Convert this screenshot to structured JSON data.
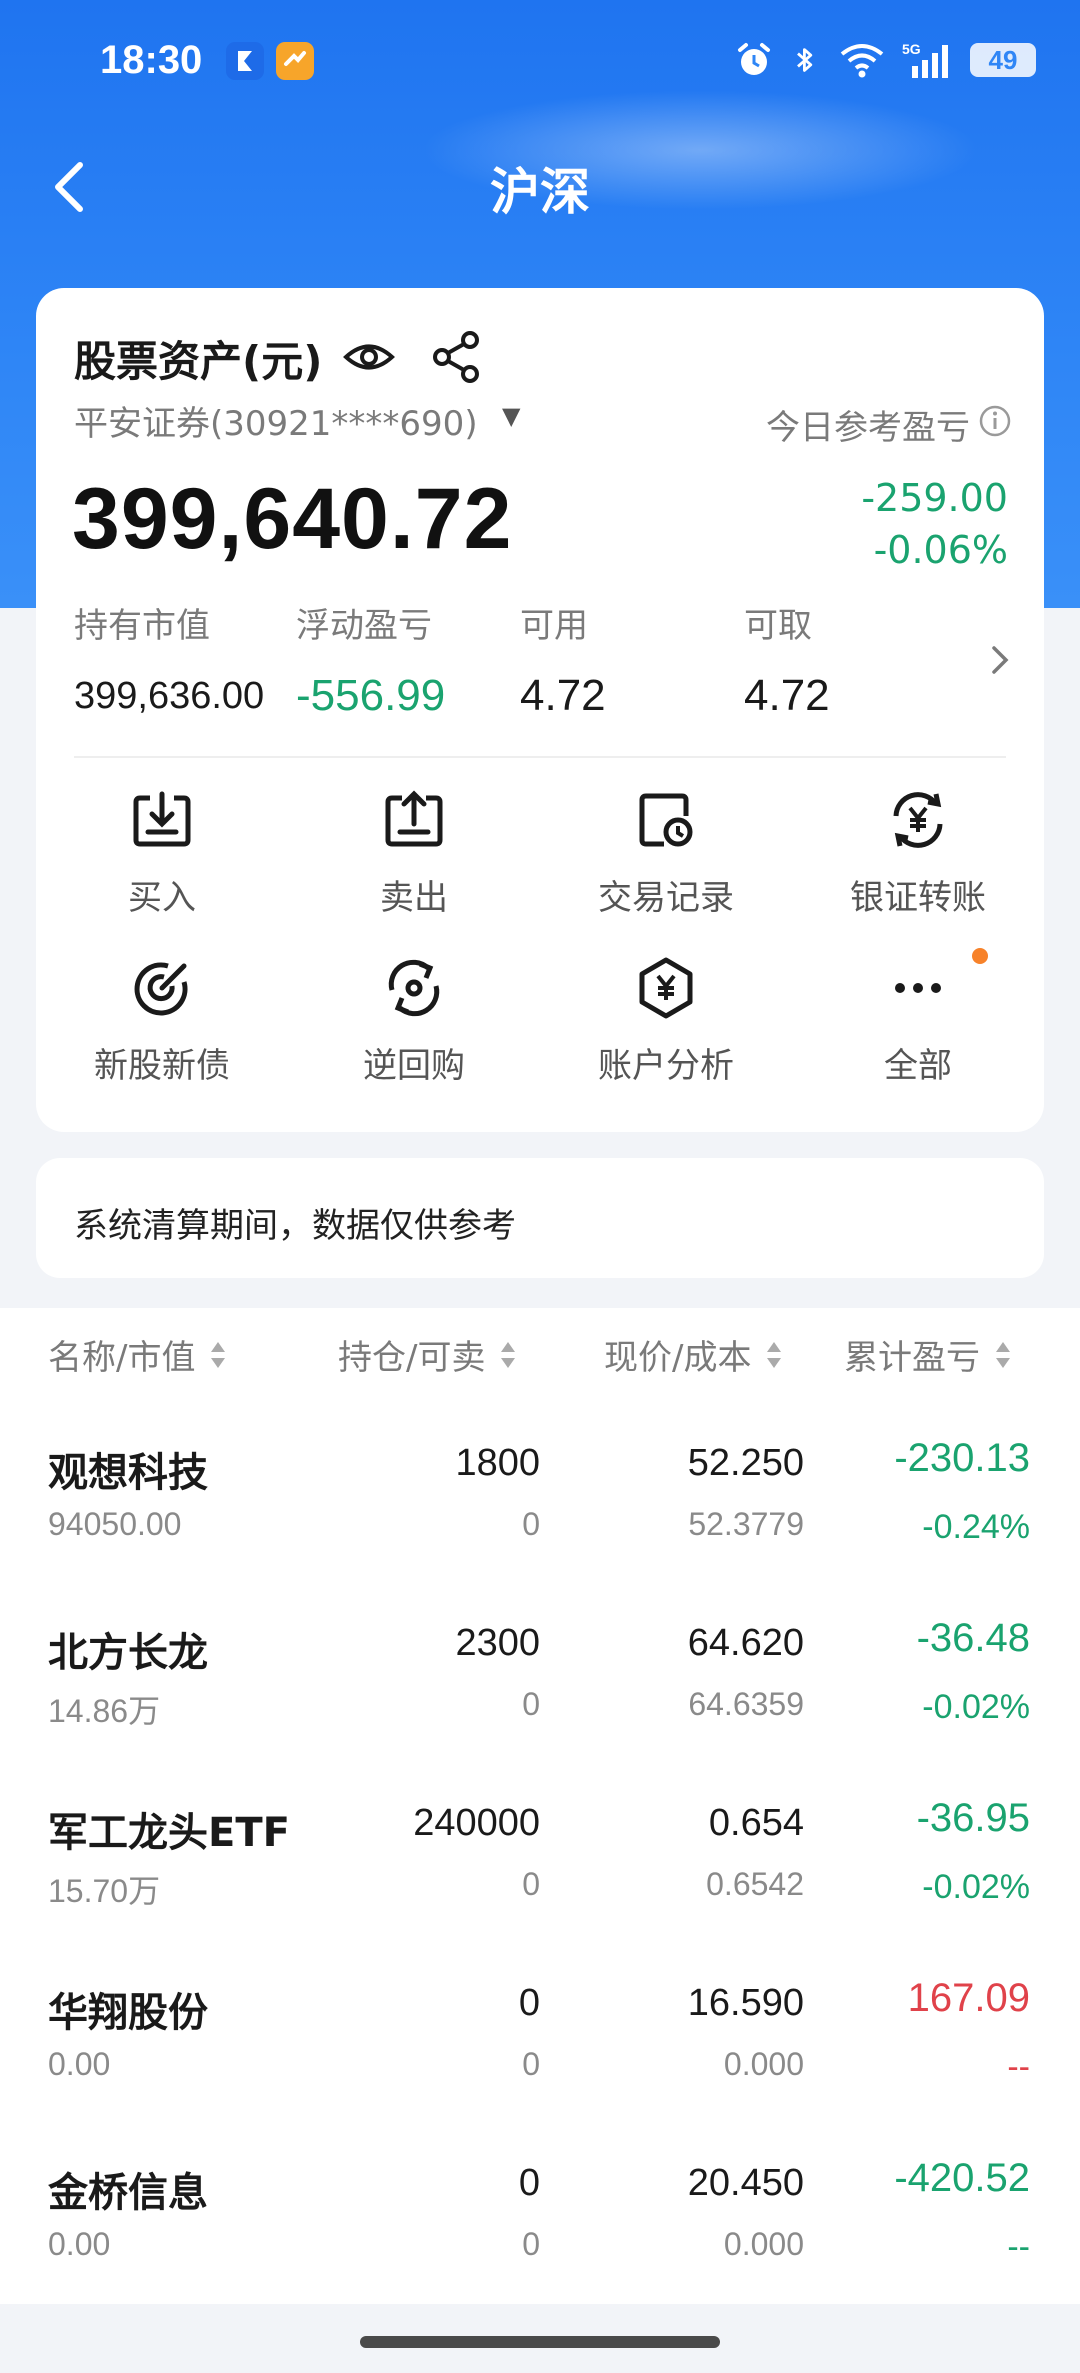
{
  "status_bar": {
    "time": "18:30",
    "battery": "49"
  },
  "nav": {
    "title": "沪深"
  },
  "asset_card": {
    "title": "股票资产(元)",
    "account": "平安证券(30921****690)",
    "today_pnl_label": "今日参考盈亏",
    "total_asset": "399,640.72",
    "today_pnl_amount": "-259.00",
    "today_pnl_pct": "-0.06%",
    "metrics": [
      {
        "label": "持有市值",
        "value": "399,636.00"
      },
      {
        "label": "浮动盈亏",
        "value": "-556.99"
      },
      {
        "label": "可用",
        "value": "4.72"
      },
      {
        "label": "可取",
        "value": "4.72"
      }
    ],
    "actions": [
      {
        "label": "买入",
        "icon": "download-tray-icon"
      },
      {
        "label": "卖出",
        "icon": "upload-tray-icon"
      },
      {
        "label": "交易记录",
        "icon": "record-clock-icon"
      },
      {
        "label": "银证转账",
        "icon": "yuan-exchange-icon"
      },
      {
        "label": "新股新债",
        "icon": "target-icon"
      },
      {
        "label": "逆回购",
        "icon": "reverse-repo-icon"
      },
      {
        "label": "账户分析",
        "icon": "hexagon-yuan-icon"
      },
      {
        "label": "全部",
        "icon": "more-dots-icon"
      }
    ]
  },
  "notice": {
    "text": "系统清算期间，数据仅供参考"
  },
  "table": {
    "headers": [
      "名称/市值",
      "持仓/可卖",
      "现价/成本",
      "累计盈亏"
    ],
    "rows": [
      {
        "name": "观想科技",
        "market_value": "94050.00",
        "position": "1800",
        "available": "0",
        "price": "52.250",
        "cost": "52.3779",
        "pnl": "-230.13",
        "pnl_pct": "-0.24%",
        "color": "green"
      },
      {
        "name": "北方长龙",
        "market_value": "14.86万",
        "position": "2300",
        "available": "0",
        "price": "64.620",
        "cost": "64.6359",
        "pnl": "-36.48",
        "pnl_pct": "-0.02%",
        "color": "green"
      },
      {
        "name": "军工龙头ETF",
        "market_value": "15.70万",
        "position": "240000",
        "available": "0",
        "price": "0.654",
        "cost": "0.6542",
        "pnl": "-36.95",
        "pnl_pct": "-0.02%",
        "color": "green"
      },
      {
        "name": "华翔股份",
        "market_value": "0.00",
        "position": "0",
        "available": "0",
        "price": "16.590",
        "cost": "0.000",
        "pnl": "167.09",
        "pnl_pct": "--",
        "color": "red"
      },
      {
        "name": "金桥信息",
        "market_value": "0.00",
        "position": "0",
        "available": "0",
        "price": "20.450",
        "cost": "0.000",
        "pnl": "-420.52",
        "pnl_pct": "--",
        "color": "green"
      }
    ]
  },
  "colors": {
    "brand_blue": "#2f86f6",
    "gain_red": "#e0424a",
    "loss_green": "#1aa36f",
    "accent_orange": "#f7822a"
  }
}
